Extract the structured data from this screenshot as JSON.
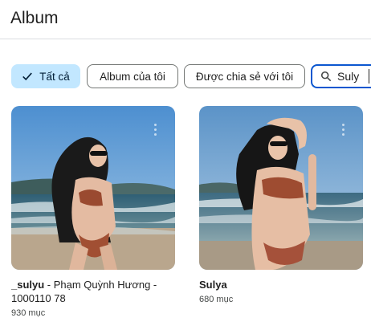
{
  "header": {
    "title": "Album"
  },
  "filters": {
    "all_label": "Tất cả",
    "mine_label": "Album của tôi",
    "shared_label": "Được chia sẻ với tôi"
  },
  "search": {
    "value": "Suly",
    "icon": "search-icon"
  },
  "albums": [
    {
      "title_bold": "_sulyu",
      "title_rest": " - Phạm Quỳnh Hương - 1000110 78",
      "count": "930 mục",
      "menu_icon": "more-vertical-icon"
    },
    {
      "title_bold": "Sulya",
      "title_rest": "",
      "count": "680 mục",
      "menu_icon": "more-vertical-icon"
    }
  ],
  "colors": {
    "accent": "#0b57d0",
    "chip_selected_bg": "#c2e7ff",
    "divider": "#dadce0"
  }
}
